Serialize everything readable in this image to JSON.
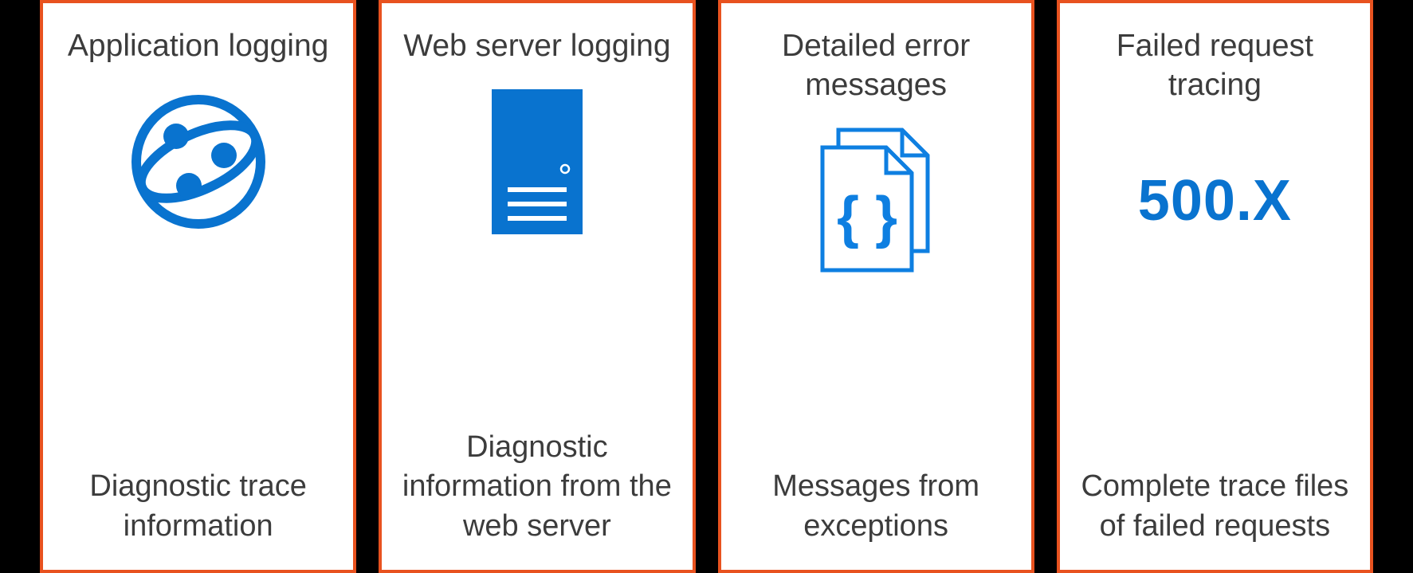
{
  "cards": [
    {
      "title": "Application logging",
      "description": "Diagnostic trace information",
      "icon": "globe-network-icon"
    },
    {
      "title": "Web server logging",
      "description": "Diagnostic information from the web server",
      "icon": "server-icon"
    },
    {
      "title": "Detailed error messages",
      "description": "Messages from exceptions",
      "icon": "code-document-icon"
    },
    {
      "title": "Failed request tracing",
      "description": "Complete trace files of failed requests",
      "icon": "error-code-text",
      "icon_text": "500.X"
    }
  ],
  "colors": {
    "border": "#E8521F",
    "icon_blue_fill": "#0973CF",
    "icon_blue_stroke": "#0E7FE1",
    "text": "#3c3c3c"
  }
}
